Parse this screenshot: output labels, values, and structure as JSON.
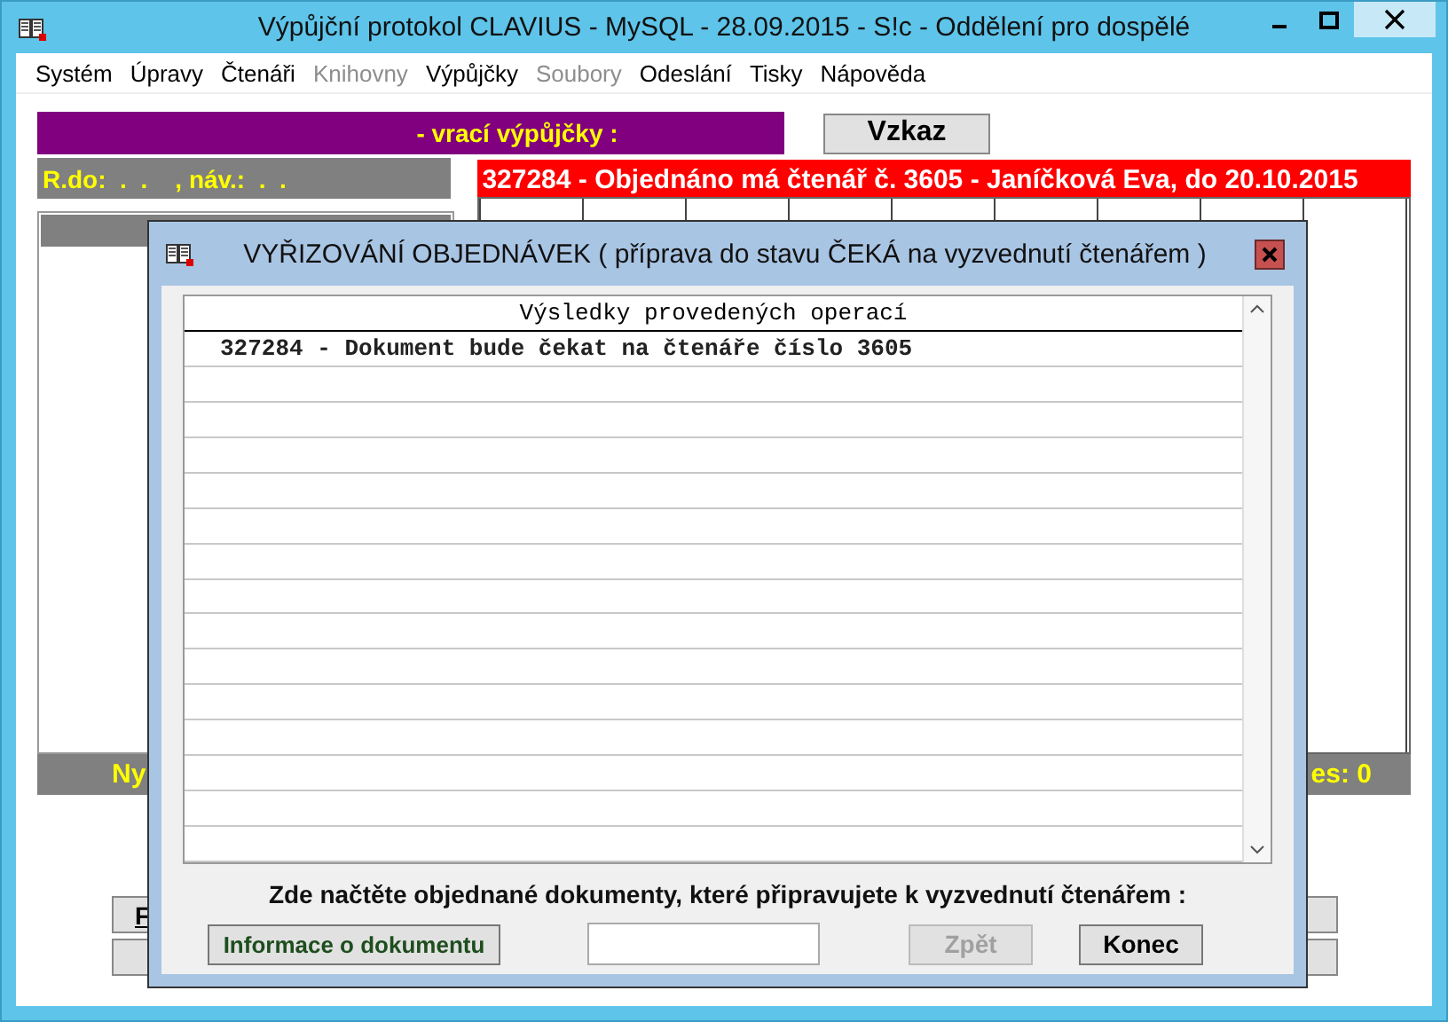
{
  "window": {
    "title": "Výpůjční protokol CLAVIUS - MySQL - 28.09.2015 - S!c - Oddělení pro dospělé"
  },
  "menu": [
    {
      "label": "Systém",
      "disabled": false
    },
    {
      "label": "Úpravy",
      "disabled": false
    },
    {
      "label": "Čtenáři",
      "disabled": false
    },
    {
      "label": "Knihovny",
      "disabled": true
    },
    {
      "label": "Výpůjčky",
      "disabled": false
    },
    {
      "label": "Soubory",
      "disabled": true
    },
    {
      "label": "Odeslání",
      "disabled": false
    },
    {
      "label": "Tisky",
      "disabled": false
    },
    {
      "label": "Nápověda",
      "disabled": false
    }
  ],
  "mode_banner": "- vrací výpůjčky :",
  "message_button": "Vzkaz",
  "dates": "R.do:  .  .    , náv.:  .  .",
  "alert": "327284 - Objednáno má čtenář č. 3605 - Janíčková Eva, do 20.10.2015",
  "status_bar": {
    "left": "Ny",
    "right": "es: 0"
  },
  "bottom_buttons": [
    {
      "label": "F"
    }
  ],
  "dialog": {
    "title": "VYŘIZOVÁNÍ OBJEDNÁVEK ( příprava do stavu ČEKÁ na vyzvednutí čtenářem )",
    "results": {
      "header": "Výsledky provedených operací",
      "rows": [
        "327284 - Dokument bude čekat na čtenáře číslo 3605"
      ]
    },
    "prompt": "Zde načtěte objednané dokumenty, které připravujete k vyzvednutí čtenářem :",
    "buttons": [
      {
        "label": "Informace o dokumentu",
        "kind": "info",
        "disabled": false
      },
      {
        "kind": "field"
      },
      {
        "label": "Zpět",
        "kind": "plain",
        "disabled": true
      },
      {
        "label": "Konec",
        "kind": "plain",
        "disabled": false
      }
    ]
  }
}
